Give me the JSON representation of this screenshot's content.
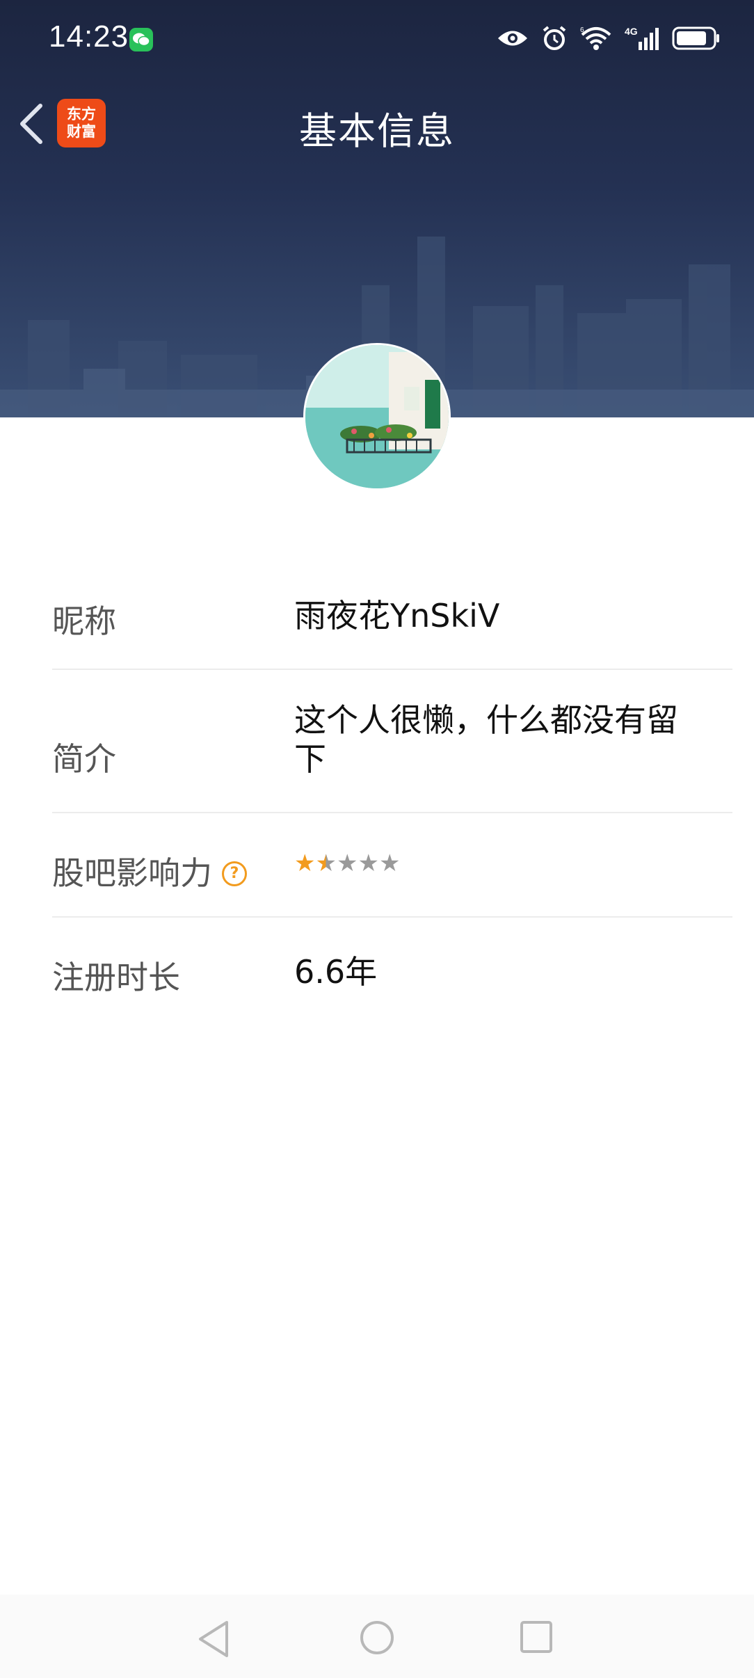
{
  "status_bar": {
    "time": "14:23",
    "icons": [
      "wechat-icon",
      "eye-icon",
      "alarm-icon",
      "wifi-icon",
      "signal-4g-icon",
      "battery-icon"
    ]
  },
  "header": {
    "back_icon": "chevron-left-icon",
    "app_logo": {
      "line1": "东方",
      "line2": "财富"
    },
    "title": "基本信息"
  },
  "profile": {
    "avatar": "avatar-image"
  },
  "info_rows": [
    {
      "label": "昵称",
      "value": "雨夜花YnSkiV"
    },
    {
      "label": "简介",
      "value": "这个人很懒，什么都没有留下"
    },
    {
      "label": "股吧影响力",
      "help_icon": "?",
      "rating": 1.5,
      "rating_max": 5
    },
    {
      "label": "注册时长",
      "value": "6.6年"
    }
  ],
  "colors": {
    "banner": "#243153",
    "accent_orange": "#f29b1e",
    "logo_red": "#ee4b18"
  },
  "system_nav": [
    "back-triangle-icon",
    "home-circle-icon",
    "recents-square-icon"
  ]
}
